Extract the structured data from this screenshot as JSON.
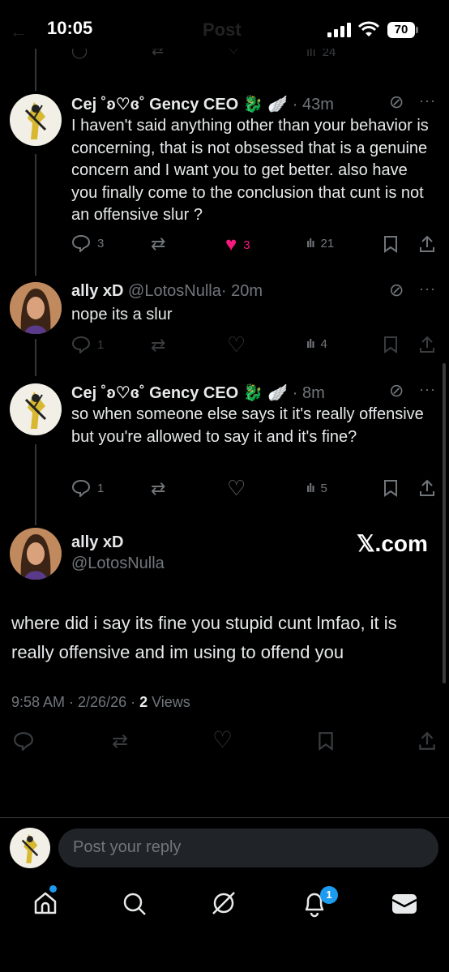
{
  "status": {
    "time": "10:05",
    "battery": "70"
  },
  "header": {
    "title": "Post"
  },
  "top_partial": {
    "views": "24"
  },
  "posts": [
    {
      "name": "Cej ˚ʚ♡ɞ˚ Gency CEO",
      "emoji": "🐉",
      "feather": "🪽",
      "time": "· 43m",
      "text": "I haven't said anything other than your behavior is concerning, that is not obsessed that is a genuine concern and I want you to get better. also have you finally come to the conclusion that cunt is not an offensive slur ?",
      "replies": "3",
      "likes": "3",
      "views": "21"
    },
    {
      "name": "ally xD",
      "handle": "@LotosNulla",
      "time": "· 20m",
      "text": "nope its a slur",
      "replies": "1",
      "views": "4"
    },
    {
      "name": "Cej ˚ʚ♡ɞ˚ Gency CEO",
      "emoji": "🐉",
      "feather": "🪽",
      "time": "· 8m",
      "text": "so when someone else says it it's really offensive but you're allowed to say it and it's fine?",
      "replies": "1",
      "views": "5"
    }
  ],
  "main_post": {
    "name": "ally xD",
    "handle": "@LotosNulla",
    "watermark": "𝕏.com",
    "text": "where did i say its fine you stupid cunt lmfao, it is really offensive and im using to offend you",
    "meta_time": "9:58 AM · 2/26/26 · ",
    "views_count": "2",
    "views_label": " Views"
  },
  "reply": {
    "placeholder": "Post your reply"
  },
  "nav": {
    "notifications_badge": "1"
  },
  "colors": {
    "like_pink": "#f91880",
    "accent_blue": "#1d9bf0",
    "muted": "#71767b"
  }
}
